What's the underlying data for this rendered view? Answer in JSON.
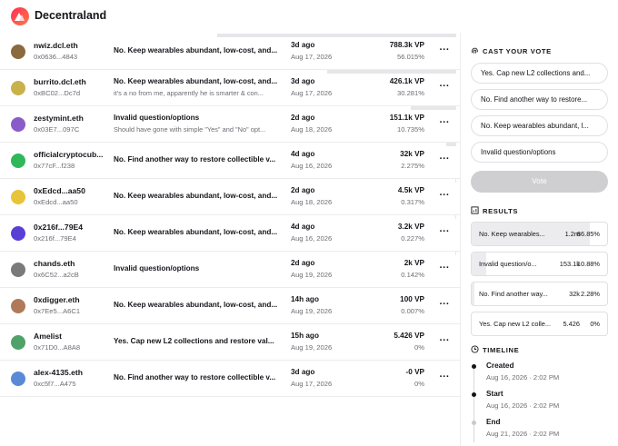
{
  "header": {
    "brand": "Decentraland"
  },
  "votes": [
    {
      "name": "nwiz.dcl.eth",
      "address": "0x0636...4843",
      "choice": "No. Keep wearables abundant, low-cost, and...",
      "reason": "",
      "when": "3d ago",
      "date": "Aug 17, 2026",
      "vp": "788.3k VP",
      "pct": "56.015%",
      "share": 0.56015,
      "avatar_color": "#8a6a3e"
    },
    {
      "name": "burrito.dcl.eth",
      "address": "0xBC02...Dc7d",
      "choice": "No. Keep wearables abundant, low-cost, and...",
      "reason": "it's a no from me, apparently he is smarter & con...",
      "when": "3d ago",
      "date": "Aug 17, 2026",
      "vp": "426.1k VP",
      "pct": "30.281%",
      "share": 0.30281,
      "avatar_color": "#c9b24a"
    },
    {
      "name": "zestymint.eth",
      "address": "0x03E7...097C",
      "choice": "Invalid question/options",
      "reason": "Should have gone with simple \"Yes\" and \"No\" opt...",
      "when": "2d ago",
      "date": "Aug 18, 2026",
      "vp": "151.1k VP",
      "pct": "10.735%",
      "share": 0.10735,
      "avatar_color": "#8a5cc9"
    },
    {
      "name": "officialcryptocub...",
      "address": "0x77cF...f238",
      "choice": "No. Find another way to restore collectible v...",
      "reason": "",
      "when": "4d ago",
      "date": "Aug 16, 2026",
      "vp": "32k VP",
      "pct": "2.275%",
      "share": 0.02275,
      "avatar_color": "#2fb85a"
    },
    {
      "name": "0xEdcd...aa50",
      "address": "0xEdcd...aa50",
      "choice": "No. Keep wearables abundant, low-cost, and...",
      "reason": "",
      "when": "2d ago",
      "date": "Aug 18, 2026",
      "vp": "4.5k VP",
      "pct": "0.317%",
      "share": 0.00317,
      "avatar_color": "#e8c43a"
    },
    {
      "name": "0x216f...79E4",
      "address": "0x216f...79E4",
      "choice": "No. Keep wearables abundant, low-cost, and...",
      "reason": "",
      "when": "4d ago",
      "date": "Aug 16, 2026",
      "vp": "3.2k VP",
      "pct": "0.227%",
      "share": 0.00227,
      "avatar_color": "#5a3fd6"
    },
    {
      "name": "chands.eth",
      "address": "0x6C52...a2cB",
      "choice": "Invalid question/options",
      "reason": "",
      "when": "2d ago",
      "date": "Aug 19, 2026",
      "vp": "2k VP",
      "pct": "0.142%",
      "share": 0.00142,
      "avatar_color": "#7a7a7a"
    },
    {
      "name": "0xdigger.eth",
      "address": "0x7Ee5...A6C1",
      "choice": "No. Keep wearables abundant, low-cost, and...",
      "reason": "",
      "when": "14h ago",
      "date": "Aug 19, 2026",
      "vp": "100 VP",
      "pct": "0.007%",
      "share": 7e-05,
      "avatar_color": "#b07a5a"
    },
    {
      "name": "Amelist",
      "address": "0x71D0...A8A8",
      "choice": "Yes. Cap new L2 collections and restore val...",
      "reason": "",
      "when": "15h ago",
      "date": "Aug 19, 2026",
      "vp": "5.426 VP",
      "pct": "0%",
      "share": 0,
      "avatar_color": "#4fa36a"
    },
    {
      "name": "alex-4135.eth",
      "address": "0xc5f7...A475",
      "choice": "No. Find another way to restore collectible v...",
      "reason": "",
      "when": "3d ago",
      "date": "Aug 17, 2026",
      "vp": "-0 VP",
      "pct": "0%",
      "share": 0,
      "avatar_color": "#5a8ad6"
    }
  ],
  "sidebar": {
    "cast_title": "CAST YOUR VOTE",
    "options": [
      "Yes. Cap new L2 collections and...",
      "No. Find another way to restore...",
      "No. Keep wearables abundant, l...",
      "Invalid question/options"
    ],
    "vote_label": "Vote",
    "results_title": "RESULTS",
    "results": [
      {
        "label": "No. Keep wearables...",
        "vp": "1.2m",
        "pct": "86.85%",
        "share": 0.8685
      },
      {
        "label": "Invalid question/o...",
        "vp": "153.1k",
        "pct": "10.88%",
        "share": 0.1088
      },
      {
        "label": "No. Find another way...",
        "vp": "32k",
        "pct": "2.28%",
        "share": 0.0228
      },
      {
        "label": "Yes. Cap new L2 colle...",
        "vp": "5.426",
        "pct": "0%",
        "share": 0
      }
    ],
    "timeline_title": "TIMELINE",
    "timeline": [
      {
        "label": "Created",
        "date": "Aug 16, 2026 · 2:02 PM",
        "active": true
      },
      {
        "label": "Start",
        "date": "Aug 16, 2026 · 2:02 PM",
        "active": true
      },
      {
        "label": "End",
        "date": "Aug 21, 2026 · 2:02 PM",
        "active": false
      }
    ]
  },
  "colors": {
    "brand": "#ff2d55",
    "bar": "#e7e7ea",
    "muted": "#6d6b72",
    "button_disabled": "#cfcfd2"
  }
}
